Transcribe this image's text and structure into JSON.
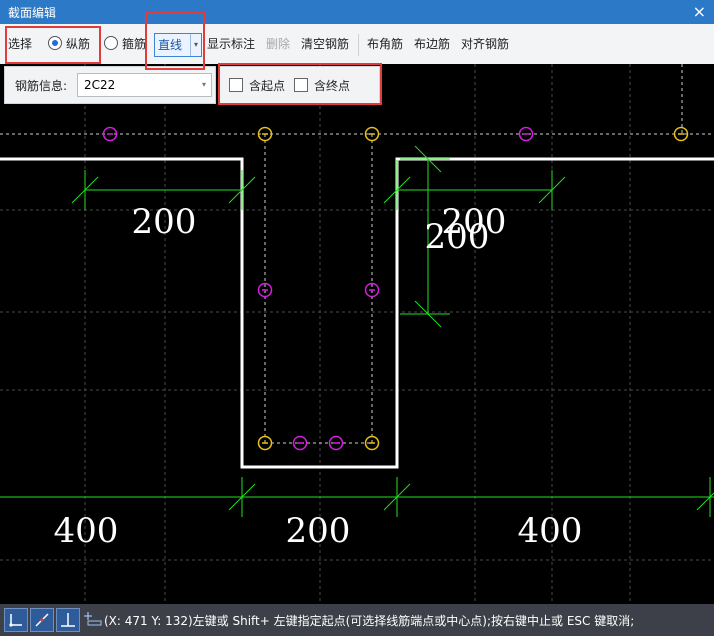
{
  "window": {
    "title": "截面编辑",
    "close_glyph": "×"
  },
  "toolbar": {
    "select_label": "选择",
    "longitudinal_label": "纵筋",
    "stirrup_label": "箍筋",
    "draw_mode": {
      "selected": "直线"
    },
    "show_dimension_label": "显示标注",
    "delete_label": "删除",
    "clear_rebar_label": "清空钢筋",
    "corner_rebar_label": "布角筋",
    "edge_rebar_label": "布边筋",
    "align_rebar_label": "对齐钢筋"
  },
  "rebar_panel": {
    "label": "钢筋信息:",
    "value": "2C22"
  },
  "options": {
    "start_point_label": "含起点",
    "end_point_label": "含终点"
  },
  "dimensions": {
    "left_flange": "200",
    "right_flange": "200",
    "right_vertical": "200",
    "bottom_left": "400",
    "bottom_mid": "200",
    "bottom_right": "400"
  },
  "status": {
    "text": "(X: 471 Y: 132)左键或 Shift+ 左键指定起点(可选择线筋端点或中心点);按右键中止或 ESC 键取消;"
  },
  "colors": {
    "canvas_bg": "#000000",
    "section_outline": "#ffffff",
    "dimension_line": "#22e022",
    "rebar_corner": "#e8c318",
    "rebar_edge": "#d51fe0",
    "highlight_box": "#e23b3b",
    "title_bar": "#2b79c7"
  },
  "icons": [
    "close-icon",
    "snap-orthogonal-icon",
    "snap-angle-icon",
    "snap-axis-icon",
    "coordinate-icon"
  ]
}
